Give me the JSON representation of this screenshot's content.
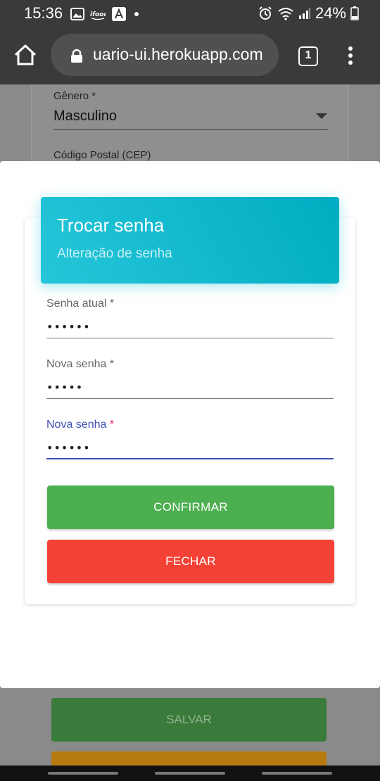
{
  "status_bar": {
    "time": "15:36",
    "battery": "24%",
    "icons_left": [
      "image-icon",
      "ifood-icon",
      "a-app-icon",
      "dot-icon"
    ],
    "icons_right": [
      "alarm-icon",
      "wifi-icon",
      "signal-icon",
      "battery-icon"
    ]
  },
  "browser": {
    "url": "uario-ui.herokuapp.com",
    "tab_count": "1"
  },
  "background_page": {
    "genero_label": "Gênero *",
    "genero_value": "Masculino",
    "cep_label": "Código Postal (CEP)",
    "save_label": "SALVAR"
  },
  "modal": {
    "title": "Trocar senha",
    "subtitle": "Alteração de senha",
    "fields": [
      {
        "label": "Senha atual",
        "required_mark": "*",
        "value": "123456"
      },
      {
        "label": "Nova senha",
        "required_mark": "*",
        "value": "12345"
      },
      {
        "label": "Nova senha",
        "required_mark": "*",
        "value": "123456"
      }
    ],
    "confirm_label": "CONFIRMAR",
    "close_label": "FECHAR"
  },
  "colors": {
    "header_cyan": "#00acc1",
    "confirm_green": "#4caf50",
    "close_red": "#f44336",
    "focus_indigo": "#3f51b5",
    "required_pink": "#e91e63"
  }
}
